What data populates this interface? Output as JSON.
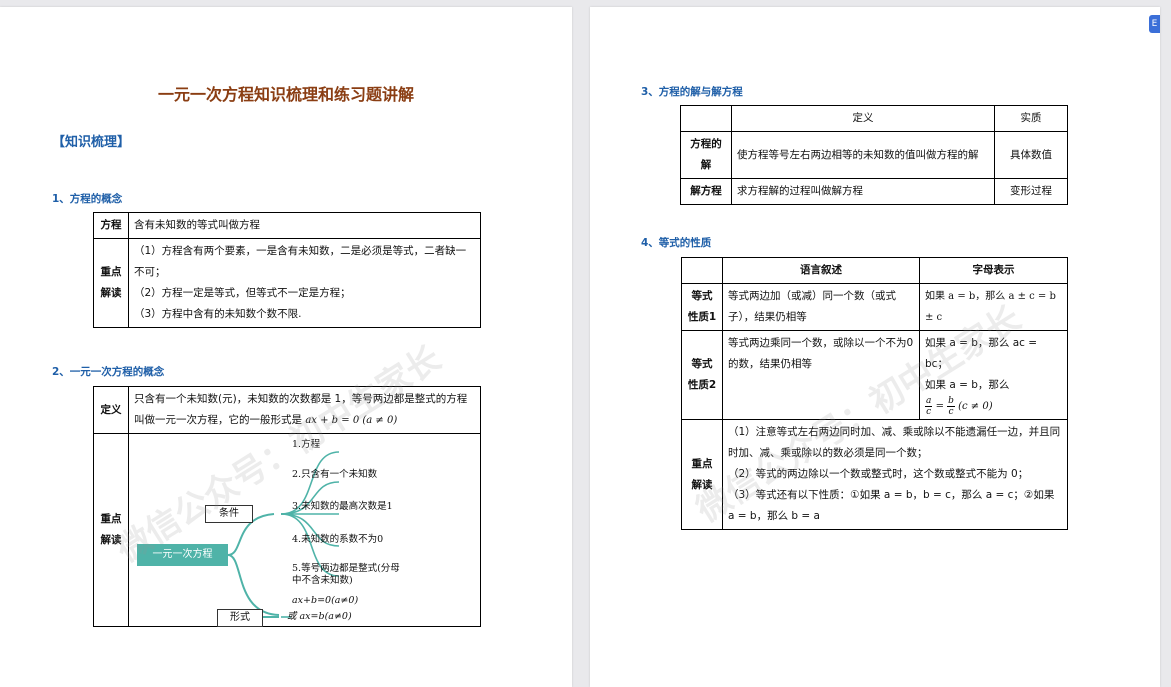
{
  "doc_title": "一元一次方程知识梳理和练习题讲解",
  "side_tab": "E",
  "left": {
    "heading": "【知识梳理】",
    "s1": {
      "title": "1、方程的概念",
      "row1_label": "方程",
      "row1_text": "含有未知数的等式叫做方程",
      "row2_label": "重点解读",
      "row2_lines": [
        "（1）方程含有两个要素，一是含有未知数，二是必须是等式，二者缺一不可；",
        "（2）方程一定是等式，但等式不一定是方程；",
        "（3）方程中含有的未知数个数不限."
      ]
    },
    "s2": {
      "title": "2、一元一次方程的概念",
      "row1_label": "定义",
      "row1_text_a": "只含有一个未知数(元)，未知数的次数都是 1，等号两边都是整式的方程叫做一元一次方程，它的一般形式是",
      "row1_formula": "ax + b = 0 (a ≠ 0)",
      "row2_label": "重点解读",
      "mindmap": {
        "root": "一元一次方程",
        "cond": "条件",
        "form": "形式",
        "leaves": [
          "1.方程",
          "2.只含有一个未知数",
          "3.未知数的最高次数是1",
          "4.未知数的系数不为0",
          "5.等号两边都是整式(分母中不含未知数)"
        ],
        "form1": "ax+b=0(a≠0)",
        "form2": "或 ax=b(a≠0)"
      }
    }
  },
  "right": {
    "s3": {
      "title": "3、方程的解与解方程",
      "headers": [
        "",
        "定义",
        "实质"
      ],
      "rows": [
        {
          "label": "方程的解",
          "def": "使方程等号左右两边相等的未知数的值叫做方程的解",
          "essence": "具体数值"
        },
        {
          "label": "解方程",
          "def": "求方程解的过程叫做解方程",
          "essence": "变形过程"
        }
      ]
    },
    "s4": {
      "title": "4、等式的性质",
      "headers": [
        "",
        "语言叙述",
        "字母表示"
      ],
      "p1_label": "等式性质1",
      "p1_text": "等式两边加（或减）同一个数（或式子），结果仍相等",
      "p1_formula": "如果 a = b，那么 a ± c = b ± c",
      "p2_label": "等式性质2",
      "p2_text": "等式两边乘同一个数，或除以一个不为0的数，结果仍相等",
      "p2_formula1": "如果 a = b，那么 ac = bc；",
      "p2_formula2": "如果 a = b，那么",
      "p2_frac_a": "a",
      "p2_frac_c1": "c",
      "p2_eq": "=",
      "p2_frac_b": "b",
      "p2_frac_c2": "c",
      "p2_cond": "(c ≠ 0)",
      "p3_label": "重点解读",
      "p3_lines": [
        "（1）注意等式左右两边同时加、减、乘或除以不能遗漏任一边，并且同时加、减、乘或除以的数必须是同一个数；",
        "（2）等式的两边除以一个数或整式时，这个数或整式不能为 0；",
        "（3）等式还有以下性质：①如果 a = b，b = c，那么 a = c；②如果 a = b，那么 b = a"
      ]
    }
  },
  "watermark_left_1": "微信公众号：初中生家长",
  "watermark_right_1": "微信公众号：初中生家长"
}
